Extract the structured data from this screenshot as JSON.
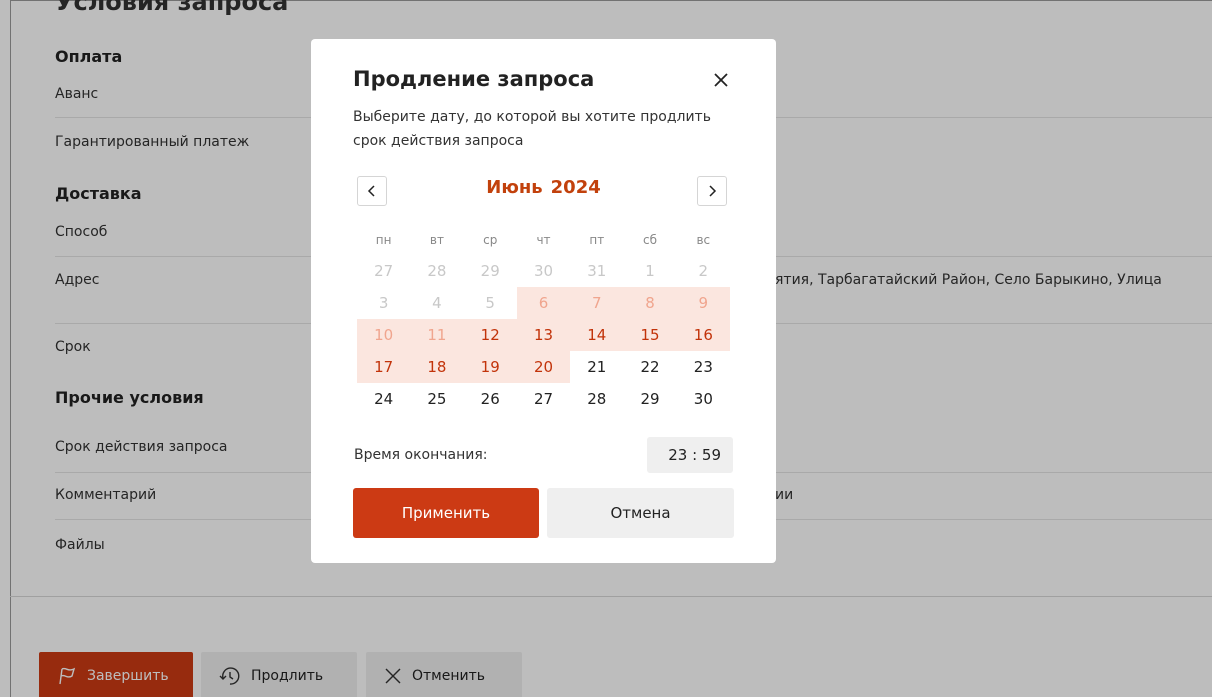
{
  "page": {
    "section_title": "Условия запроса",
    "groups": [
      {
        "title": "Оплата",
        "rows": [
          {
            "label": "Аванс",
            "value": ""
          },
          {
            "label": "Гарантированный платеж",
            "value": ""
          }
        ]
      },
      {
        "title": "Доставка",
        "rows": [
          {
            "label": "Способ",
            "value": ""
          },
          {
            "label": "Адрес",
            "value": "ятия, Тарбагатайский Район, Село Барыкино, Улица"
          },
          {
            "label": "Срок",
            "value": ""
          }
        ]
      },
      {
        "title": "Прочие условия",
        "rows": [
          {
            "label": "Срок действия запроса",
            "value": ""
          },
          {
            "label": "Комментарий",
            "value": "ии"
          },
          {
            "label": "Файлы",
            "value": ""
          }
        ]
      }
    ],
    "actions": {
      "finish_label": "Завершить",
      "extend_label": "Продлить",
      "cancel_label": "Отменить"
    }
  },
  "modal": {
    "title": "Продление запроса",
    "description": "Выберите дату, до которой вы хотите продлить срок действия запроса",
    "calendar": {
      "month": "Июнь",
      "year": "2024",
      "weekdays": [
        "пн",
        "вт",
        "ср",
        "чт",
        "пт",
        "сб",
        "вс"
      ],
      "weeks": [
        [
          {
            "d": "27",
            "s": "out"
          },
          {
            "d": "28",
            "s": "out"
          },
          {
            "d": "29",
            "s": "out"
          },
          {
            "d": "30",
            "s": "out"
          },
          {
            "d": "31",
            "s": "out"
          },
          {
            "d": "1",
            "s": "out"
          },
          {
            "d": "2",
            "s": "out"
          }
        ],
        [
          {
            "d": "3",
            "s": "out"
          },
          {
            "d": "4",
            "s": "out"
          },
          {
            "d": "5",
            "s": "out"
          },
          {
            "d": "6",
            "s": "hl-muted"
          },
          {
            "d": "7",
            "s": "hl-muted"
          },
          {
            "d": "8",
            "s": "hl-muted"
          },
          {
            "d": "9",
            "s": "hl-muted"
          }
        ],
        [
          {
            "d": "10",
            "s": "hl-muted"
          },
          {
            "d": "11",
            "s": "hl-muted"
          },
          {
            "d": "12",
            "s": "hl-strong"
          },
          {
            "d": "13",
            "s": "hl-strong"
          },
          {
            "d": "14",
            "s": "hl-strong"
          },
          {
            "d": "15",
            "s": "hl-strong"
          },
          {
            "d": "16",
            "s": "hl-strong"
          }
        ],
        [
          {
            "d": "17",
            "s": "hl-strong"
          },
          {
            "d": "18",
            "s": "hl-strong"
          },
          {
            "d": "19",
            "s": "hl-strong"
          },
          {
            "d": "20",
            "s": "hl-strong"
          },
          {
            "d": "21",
            "s": "normal"
          },
          {
            "d": "22",
            "s": "normal"
          },
          {
            "d": "23",
            "s": "normal"
          }
        ],
        [
          {
            "d": "24",
            "s": "normal"
          },
          {
            "d": "25",
            "s": "normal"
          },
          {
            "d": "26",
            "s": "normal"
          },
          {
            "d": "27",
            "s": "normal"
          },
          {
            "d": "28",
            "s": "normal"
          },
          {
            "d": "29",
            "s": "normal"
          },
          {
            "d": "30",
            "s": "normal"
          }
        ]
      ]
    },
    "time_label": "Время окончания:",
    "time_value": "23 : 59",
    "apply_label": "Применить",
    "dismiss_label": "Отмена"
  },
  "colors": {
    "accent": "#cc3a14",
    "range_bg": "#fbe6df",
    "range_text": "#c2330a",
    "overlay": "rgba(0,0,0,0.26)"
  },
  "icons": {
    "finish": "flag-icon",
    "extend": "clock-rotate-icon",
    "cancel": "close-icon",
    "modal_close": "close-icon",
    "prev_month": "chevron-left-icon",
    "next_month": "chevron-right-icon"
  }
}
